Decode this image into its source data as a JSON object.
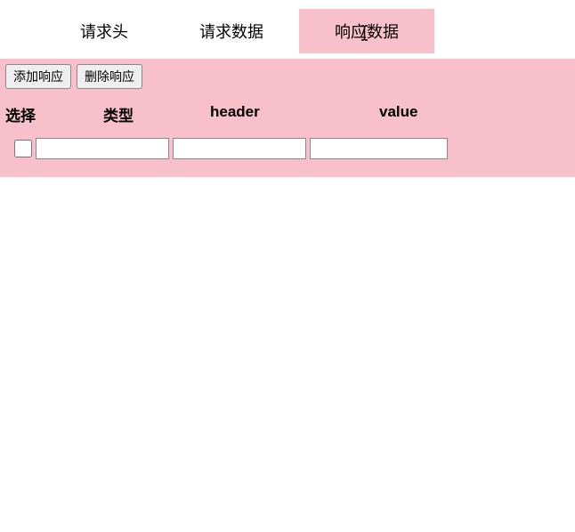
{
  "tabs": {
    "request_headers": "请求头",
    "request_data": "请求数据",
    "response_data": "响应数据"
  },
  "toolbar": {
    "add_response": "添加响应",
    "delete_response": "删除响应"
  },
  "table": {
    "headers": {
      "select": "选择",
      "type": "类型",
      "header": "header",
      "value": "value"
    },
    "rows": [
      {
        "checked": false,
        "type": "",
        "header": "",
        "value": ""
      }
    ]
  }
}
